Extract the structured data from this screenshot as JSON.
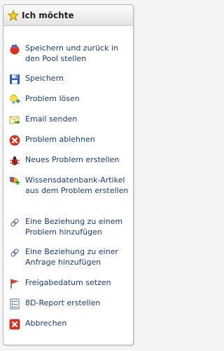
{
  "panel": {
    "title": "Ich möchte",
    "title_icon": "star-icon"
  },
  "items": [
    {
      "label": "Speichern und zurück in den Pool stellen",
      "icon": "save-return-icon"
    },
    {
      "label": "Speichern",
      "icon": "floppy-disk-icon"
    },
    {
      "label": "Problem lösen",
      "icon": "lightbulb-icon"
    },
    {
      "label": "Email senden",
      "icon": "email-icon"
    },
    {
      "label": "Problem ablehnen",
      "icon": "reject-icon"
    },
    {
      "label": "Neues Problem erstellen",
      "icon": "bug-icon"
    },
    {
      "label": "Wissensdatenbank-Artikel aus dem Problem erstellen",
      "icon": "knowledge-base-icon"
    },
    {
      "label": "Eine Beziehung zu einem Problem hinzufügen",
      "icon": "link-icon"
    },
    {
      "label": "Eine Beziehung zu einer Anfrage hinzufügen",
      "icon": "link-icon"
    },
    {
      "label": "Freigabedatum setzen",
      "icon": "flag-icon"
    },
    {
      "label": "8D-Report erstellen",
      "icon": "report-icon"
    },
    {
      "label": "Abbrechen",
      "icon": "cancel-icon"
    }
  ],
  "colors": {
    "label_text": "#1a3c6e",
    "header_bg": "#e4e4e4",
    "panel_border": "#b7b7b7"
  }
}
